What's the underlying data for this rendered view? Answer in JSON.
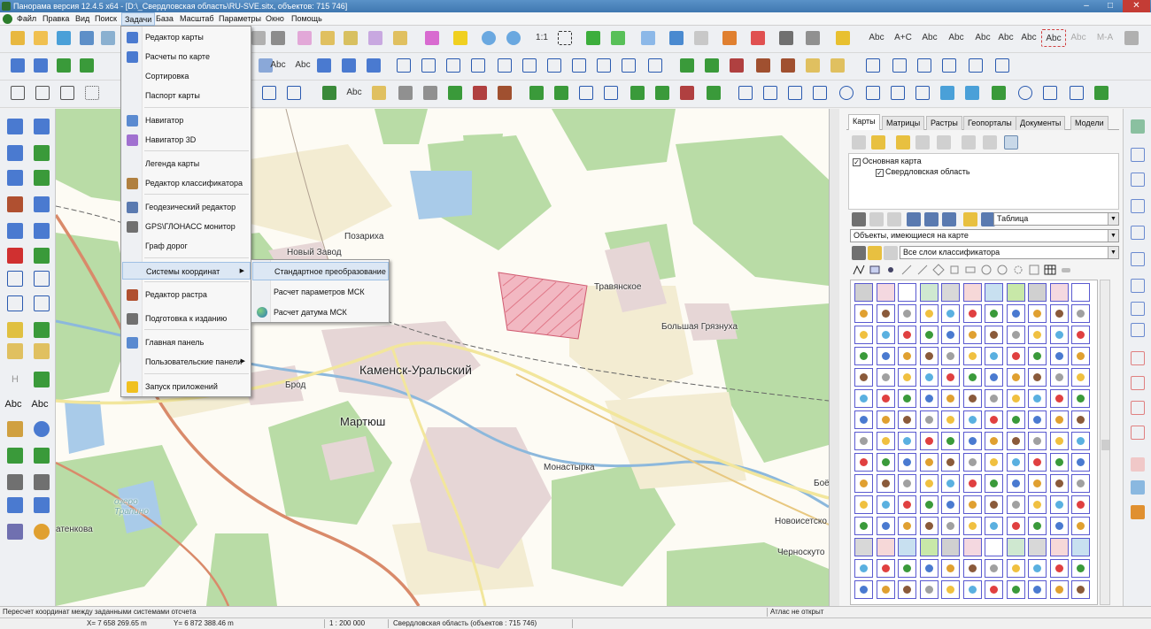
{
  "window": {
    "title": "Панорама версия 12.4.5 x64 - [D:\\_Свердловская область\\RU-SVE.sitx, объектов: 715 746]",
    "min_glyph": "–",
    "max_glyph": "□",
    "close_glyph": "✕"
  },
  "menubar": {
    "items": [
      "Файл",
      "Правка",
      "Вид",
      "Поиск",
      "Задачи",
      "База",
      "Масштаб",
      "Параметры",
      "Окно",
      "Помощь"
    ],
    "active": "Задачи"
  },
  "toolbar_labels": {
    "scale_1_1": "1:1",
    "abc": "Abc",
    "a_c": "A+C",
    "m_a": "M-A",
    "h": "H"
  },
  "tasks_menu": {
    "items": [
      {
        "label": "Редактор карты",
        "icon": "pencil-icon"
      },
      {
        "label": "Расчеты по карте",
        "icon": "ruler-icon"
      },
      {
        "label": "Сортировка",
        "icon": ""
      },
      {
        "label": "Паспорт карты",
        "icon": ""
      },
      {
        "label": "Навигатор",
        "icon": "navigator-icon"
      },
      {
        "label": "Навигатор 3D",
        "icon": "navigator-3d-icon"
      },
      {
        "label": "Легенда карты",
        "icon": ""
      },
      {
        "label": "Редактор классификатора",
        "icon": "classifier-icon"
      },
      {
        "label": "Геодезический редактор",
        "icon": "geodesy-icon"
      },
      {
        "label": "GPS\\ГЛОНАСС монитор",
        "icon": "gps-icon"
      },
      {
        "label": "Граф дорог",
        "icon": ""
      },
      {
        "label": "Системы координат",
        "icon": "",
        "submenu": true
      },
      {
        "label": "Редактор растра",
        "icon": "raster-icon"
      },
      {
        "label": "Подготовка к изданию",
        "icon": "print-icon"
      },
      {
        "label": "Главная панель",
        "icon": "main-panel-icon"
      },
      {
        "label": "Пользовательские панели",
        "icon": "",
        "submenu": true
      },
      {
        "label": "Запуск приложений",
        "icon": "lightning-icon"
      }
    ],
    "submenu_arrow": "▶"
  },
  "coord_submenu": {
    "items": [
      "Стандартное преобразование",
      "Расчет параметров МСК",
      "Расчет датума МСК"
    ]
  },
  "map_labels": {
    "kamensk": "Каменск-Уральский",
    "martyush": "Мартюш",
    "travyanskoe": "Травянское",
    "bolshaya": "Большая Грязнуха",
    "pozarikha": "Позариха",
    "novy_zavod": "Новый Завод",
    "brod": "Брод",
    "monastyrka": "Монастырка",
    "novoisetskoe": "Новоисетско",
    "chernokut": "Черноскуто",
    "boe": "Боё",
    "tatenkova": "атенкова",
    "ozero": "озеро\nТрапино"
  },
  "right_panel": {
    "tabs": [
      "Карты",
      "Матрицы",
      "Растры",
      "Геопорталы",
      "Документы",
      "Модели"
    ],
    "active_tab": "Карты",
    "tree": {
      "root": "Основная карта",
      "child": "Свердловская область"
    },
    "view_select": "Таблица",
    "objects_select": "Объекты, имеющиеся на карте",
    "layers_select": "Все слои классификатора",
    "checkmark": "✓",
    "dropdown_arrow": "▼"
  },
  "status": {
    "hint": "Пересчет координат между заданными системами отсчета",
    "atlas": "Атлас не открыт",
    "x": "X= 7 658 269.65 m",
    "y": "Y= 6 872 388.46 m",
    "scale": "1 : 200 000",
    "region": "Свердловская область  (объектов : 715 746)"
  },
  "colors": {
    "titlebar": "#3f77b0",
    "forest": "#b9dca6",
    "urban": "#e6d6d6",
    "road_major": "#d98a6a",
    "road_yellow": "#f2e69c",
    "water": "#a9cbe9",
    "menu_highlight": "#dce7f4"
  }
}
